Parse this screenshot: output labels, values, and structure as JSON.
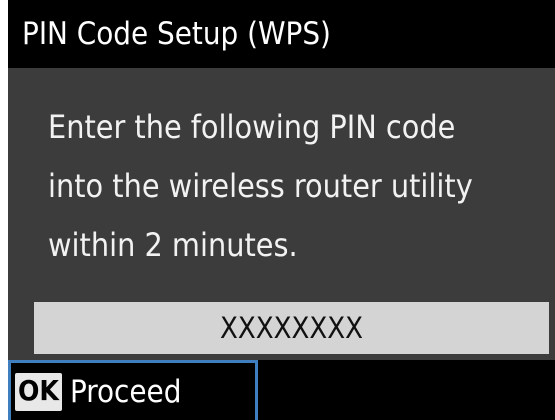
{
  "header": {
    "title": "PIN Code Setup (WPS)"
  },
  "message": {
    "lines": [
      "Enter the following PIN code",
      "into the wireless router utility",
      "within 2 minutes."
    ]
  },
  "pin": {
    "value": "XXXXXXXX"
  },
  "footer": {
    "ok_key": "OK",
    "proceed_label": "Proceed"
  },
  "colors": {
    "title_background": "#000000",
    "screen_background": "#3c3c3c",
    "pin_background": "#d4d4d4",
    "selection_outline": "#3f7fc0"
  },
  "icons": {
    "ok_key": "ok-key-icon"
  }
}
